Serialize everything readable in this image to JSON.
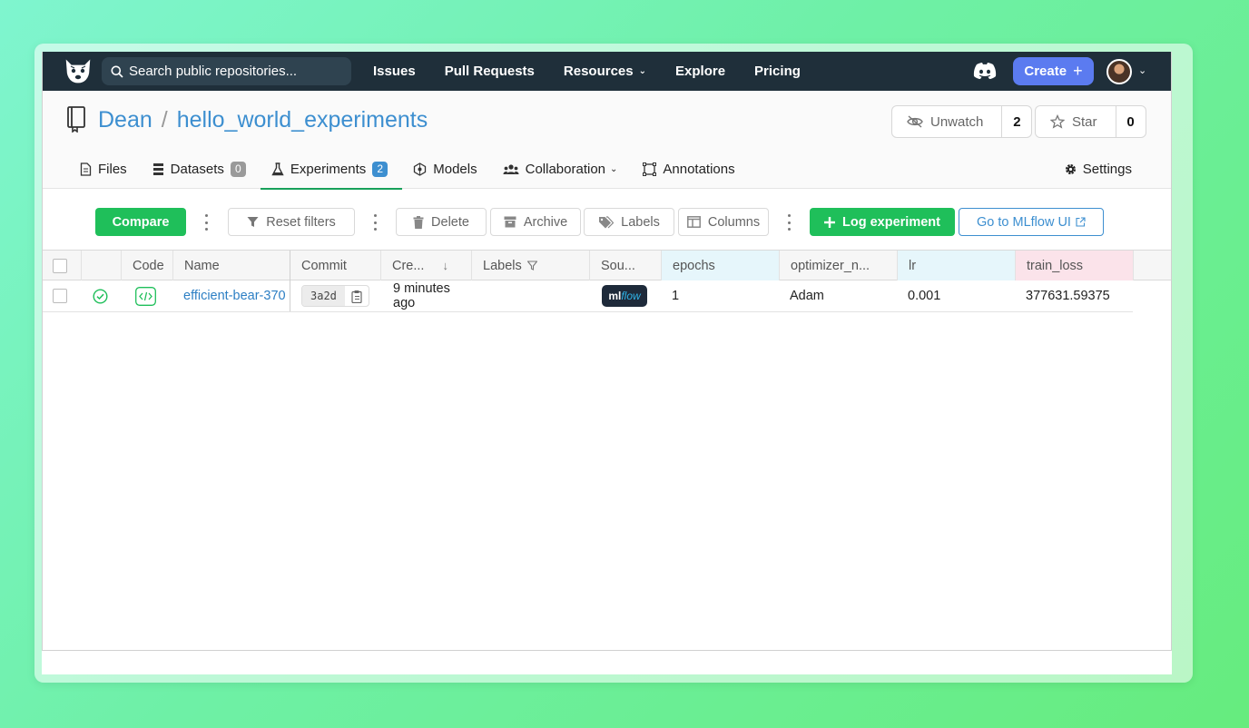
{
  "nav": {
    "search_placeholder": "Search public repositories...",
    "links": [
      "Issues",
      "Pull Requests",
      "Resources",
      "Explore",
      "Pricing"
    ],
    "create_label": "Create",
    "create_plus": "+"
  },
  "repo": {
    "owner": "Dean",
    "separator": "/",
    "name": "hello_world_experiments",
    "unwatch_label": "Unwatch",
    "watch_count": "2",
    "star_label": "Star",
    "star_count": "0"
  },
  "tabs": [
    {
      "label": "Files"
    },
    {
      "label": "Datasets",
      "badge": "0"
    },
    {
      "label": "Experiments",
      "badge": "2"
    },
    {
      "label": "Models"
    },
    {
      "label": "Collaboration"
    },
    {
      "label": "Annotations"
    }
  ],
  "settings_label": "Settings",
  "toolbar": {
    "compare": "Compare",
    "reset_filters": "Reset filters",
    "delete": "Delete",
    "archive": "Archive",
    "labels": "Labels",
    "columns": "Columns",
    "log_experiment": "Log experiment",
    "mlflow_ui": "Go to MLflow UI"
  },
  "table": {
    "headers": {
      "code": "Code",
      "name": "Name",
      "commit": "Commit",
      "created": "Cre...",
      "labels": "Labels",
      "source": "Sou...",
      "epochs": "epochs",
      "optimizer": "optimizer_n...",
      "lr": "lr",
      "train_loss": "train_loss"
    },
    "rows": [
      {
        "name": "efficient-bear-370",
        "commit": "3a2d",
        "created": "9 minutes ago",
        "source_ml": "ml",
        "source_flow": "flow",
        "epochs": "1",
        "optimizer": "Adam",
        "lr": "0.001",
        "train_loss": "377631.59375"
      }
    ]
  },
  "colors": {
    "nav_bg": "#1f2f3a",
    "accent_green": "#1fbf5a",
    "link_blue": "#3d8fd0",
    "create_blue": "#5b7bf0"
  }
}
